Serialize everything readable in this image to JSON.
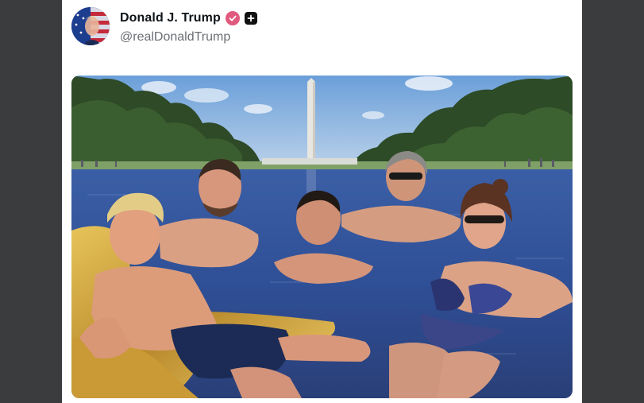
{
  "post": {
    "author": {
      "display_name": "Donald J. Trump",
      "handle": "@realDonaldTrump",
      "avatar_icon": "flag-portrait-avatar",
      "verified_icon": "verified-check-icon",
      "follow_icon": "plus-icon"
    },
    "media": {
      "type": "photo",
      "scene": "reflecting-pool-swimming-photo"
    }
  },
  "colors": {
    "window_bg": "#3a3b3d",
    "card_bg": "#ffffff",
    "verified_badge": "#e05a7e",
    "name_text": "#0f1419",
    "handle_text": "#6a6f75"
  }
}
